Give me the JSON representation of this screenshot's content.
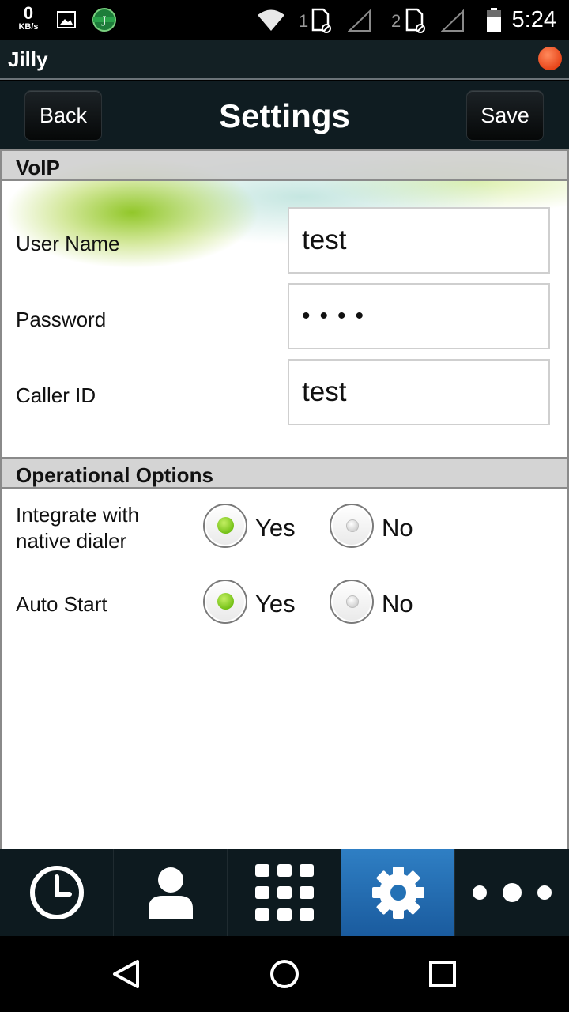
{
  "status_bar": {
    "net_speed_value": "0",
    "net_speed_unit": "KB/s",
    "sim1_label": "1",
    "sim2_label": "2",
    "time": "5:24",
    "icons": [
      "gallery-icon",
      "app-badge-icon",
      "wifi-icon",
      "sim-card-icon",
      "signal-icon",
      "battery-icon"
    ]
  },
  "app_bar": {
    "title": "Jilly",
    "indicator_color": "#e8461a"
  },
  "header": {
    "back_label": "Back",
    "title": "Settings",
    "save_label": "Save"
  },
  "voip": {
    "section_title": "VoIP",
    "fields": [
      {
        "label": "User Name",
        "value": "test"
      },
      {
        "label": "Password",
        "value": "••••"
      },
      {
        "label": "Caller ID",
        "value": "test"
      }
    ]
  },
  "operational": {
    "section_title": "Operational Options",
    "options": [
      {
        "label_line1": "Integrate with",
        "label_line2": "native dialer",
        "yes": "Yes",
        "no": "No",
        "selected": "Yes"
      },
      {
        "label_line1": "Auto Start",
        "label_line2": "",
        "yes": "Yes",
        "no": "No",
        "selected": "Yes"
      }
    ]
  },
  "bottom_nav": {
    "items": [
      "history-clock-icon",
      "contacts-person-icon",
      "dialpad-grid-icon",
      "settings-gear-icon",
      "more-dots-icon"
    ],
    "active": "settings-gear-icon",
    "accent_color": "#2f7fc4"
  },
  "system_nav": [
    "back-triangle-icon",
    "home-circle-icon",
    "recents-square-icon"
  ]
}
